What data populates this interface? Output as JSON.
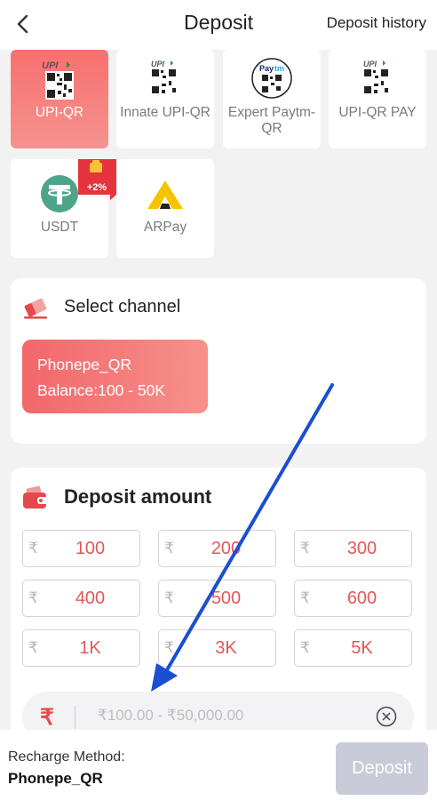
{
  "header": {
    "title": "Deposit",
    "history_label": "Deposit history"
  },
  "methods": [
    {
      "label": "UPI-QR",
      "icon": "upi-qr-icon",
      "active": true
    },
    {
      "label": "Innate UPI-QR",
      "icon": "upi-qr-icon",
      "active": false
    },
    {
      "label": "Expert Paytm-QR",
      "icon": "paytm-qr-icon",
      "active": false
    },
    {
      "label": "UPI-QR PAY",
      "icon": "upi-qr-icon",
      "active": false
    },
    {
      "label": "USDT",
      "icon": "tether-icon",
      "active": false,
      "badge": "+2%"
    },
    {
      "label": "ARPay",
      "icon": "arpay-icon",
      "active": false
    }
  ],
  "channel": {
    "title": "Select channel",
    "options": [
      {
        "name": "Phonepe_QR",
        "balance": "Balance:100 - 50K"
      }
    ]
  },
  "amount": {
    "title": "Deposit amount",
    "currency_symbol": "₹",
    "presets": [
      "100",
      "200",
      "300",
      "400",
      "500",
      "600",
      "1K",
      "3K",
      "5K"
    ],
    "input_placeholder": "₹100.00 - ₹50,000.00",
    "input_value": ""
  },
  "footer": {
    "method_label": "Recharge Method:",
    "method_value": "Phonepe_QR",
    "deposit_label": "Deposit"
  },
  "colors": {
    "accent_red": "#f2676a",
    "amount_text": "#e55757",
    "annotation_arrow": "#1b4fd1",
    "disabled_button": "#c9cbd8"
  }
}
